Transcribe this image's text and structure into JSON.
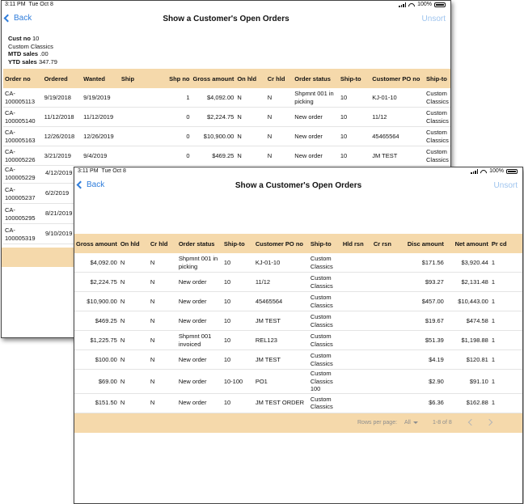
{
  "status": {
    "time": "3:11 PM",
    "date": "Tue Oct 8",
    "battery": "100%"
  },
  "nav": {
    "back_label": "Back",
    "title": "Show a Customer's Open Orders",
    "unsort_label": "Unsort"
  },
  "customer": {
    "cust_no_label": "Cust no",
    "cust_no": "10",
    "name": "Custom Classics",
    "mtd_label": "MTD sales",
    "mtd": ".00",
    "ytd_label": "YTD sales",
    "ytd": "347.79"
  },
  "table1": {
    "headers": [
      "Order no",
      "Ordered",
      "Wanted",
      "Ship",
      "Shp no",
      "Gross amount",
      "On hld",
      "Cr hld",
      "Order status",
      "Ship-to",
      "Customer PO no",
      "Ship-to"
    ],
    "rows": [
      [
        "CA-100005113",
        "9/19/2018",
        "9/19/2019",
        "",
        "1",
        "$4,092.00",
        "N",
        "N",
        "Shpmnt 001 in picking",
        "10",
        "KJ-01-10",
        "Custom Classics"
      ],
      [
        "CA-100005140",
        "11/12/2018",
        "11/12/2019",
        "",
        "0",
        "$2,224.75",
        "N",
        "N",
        "New order",
        "10",
        "11/12",
        "Custom Classics"
      ],
      [
        "CA-100005163",
        "12/26/2018",
        "12/26/2019",
        "",
        "0",
        "$10,900.00",
        "N",
        "N",
        "New order",
        "10",
        "45465564",
        "Custom Classics"
      ],
      [
        "CA-100005226",
        "3/21/2019",
        "9/4/2019",
        "",
        "0",
        "$469.25",
        "N",
        "N",
        "New order",
        "10",
        "JM TEST",
        "Custom Classics"
      ]
    ],
    "hidden_rows": [
      [
        "CA-100005229",
        "4/12/2019"
      ],
      [
        "CA-100005237",
        "6/2/2019"
      ],
      [
        "CA-100005295",
        "8/21/2019"
      ],
      [
        "CA-100005319",
        "9/10/2019"
      ]
    ]
  },
  "table2": {
    "headers": [
      "Gross amount",
      "On hld",
      "Cr hld",
      "Order status",
      "Ship-to",
      "Customer PO no",
      "Ship-to",
      "Hld rsn",
      "Cr rsn",
      "Disc amount",
      "Net amount",
      "Pr cd"
    ],
    "rows": [
      [
        "$4,092.00",
        "N",
        "N",
        "Shpmnt 001 in picking",
        "10",
        "KJ-01-10",
        "Custom Classics",
        "",
        "",
        "$171.56",
        "$3,920.44",
        "1"
      ],
      [
        "$2,224.75",
        "N",
        "N",
        "New order",
        "10",
        "11/12",
        "Custom Classics",
        "",
        "",
        "$93.27",
        "$2,131.48",
        "1"
      ],
      [
        "$10,900.00",
        "N",
        "N",
        "New order",
        "10",
        "45465564",
        "Custom Classics",
        "",
        "",
        "$457.00",
        "$10,443.00",
        "1"
      ],
      [
        "$469.25",
        "N",
        "N",
        "New order",
        "10",
        "JM TEST",
        "Custom Classics",
        "",
        "",
        "$19.67",
        "$474.58",
        "1"
      ],
      [
        "$1,225.75",
        "N",
        "N",
        "Shpmnt 001 invoiced",
        "10",
        "REL123",
        "Custom Classics",
        "",
        "",
        "$51.39",
        "$1,198.88",
        "1"
      ],
      [
        "$100.00",
        "N",
        "N",
        "New order",
        "10",
        "JM TEST",
        "Custom Classics",
        "",
        "",
        "$4.19",
        "$120.81",
        "1"
      ],
      [
        "$69.00",
        "N",
        "N",
        "New order",
        "10-100",
        "PO1",
        "Custom Classics 100",
        "",
        "",
        "$2.90",
        "$91.10",
        "1"
      ],
      [
        "$151.50",
        "N",
        "N",
        "New order",
        "10",
        "JM TEST ORDER",
        "Custom Classics",
        "",
        "",
        "$6.36",
        "$162.88",
        "1"
      ]
    ]
  },
  "pagination": {
    "rows_per_page_label": "Rows per page:",
    "rows_per_page_value": "All",
    "range": "1-8 of 8"
  },
  "colors": {
    "accent": "#2f7ddb",
    "header_bg": "#f5d9ab"
  },
  "icons": [
    "signal-icon",
    "wifi-icon",
    "battery-icon",
    "chevron-left-icon",
    "chevron-right-icon",
    "caret-down-icon"
  ]
}
